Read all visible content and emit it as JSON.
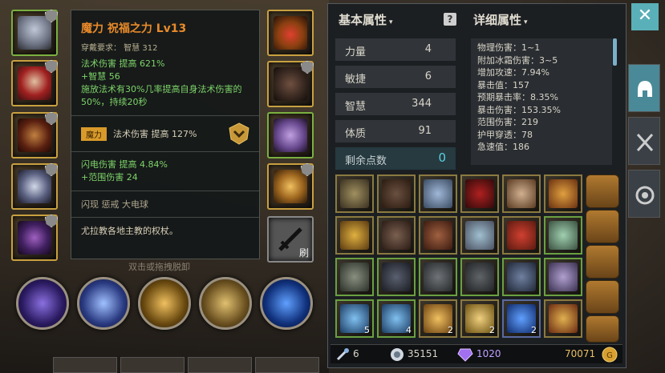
{
  "tooltip": {
    "title": "魔力 祝福之力 Lv13",
    "requirement": "穿戴要求：  智慧 312",
    "bonus1": "法术伤害 提高 621%",
    "bonus2": "+智慧 56",
    "bonus3": "施放法术有30%几率提高自身法术伤害的50%，持续20秒",
    "magic_tag": "魔力",
    "magic_bonus": "法术伤害 提高 127%",
    "lightning": "闪电伤害 提高 4.84%",
    "range": "+范围伤害 24",
    "skills": "闪现   惩戒   大电球",
    "lore": "尤拉教各地主教的权杖。"
  },
  "hint": "双击或拖拽脱卸",
  "brush_label": "刷",
  "basic_header": "基本属性",
  "detail_header": "详细属性",
  "header_arrow": "▾",
  "stats": [
    {
      "label": "力量",
      "value": "4"
    },
    {
      "label": "敏捷",
      "value": "6"
    },
    {
      "label": "智慧",
      "value": "344"
    },
    {
      "label": "体质",
      "value": "91"
    }
  ],
  "remaining": {
    "label": "剩余点数",
    "value": "0"
  },
  "details": [
    "物理伤害：1~1",
    "附加冰霜伤害：3~5",
    "增加攻速：7.94%",
    "暴击值：157",
    "预期暴击率：8.35%",
    "暴击伤害：153.35%",
    "范围伤害：219",
    "护甲穿透：78",
    "急速值：186"
  ],
  "inventory_counts": {
    "c1": "5",
    "c2": "4",
    "c3": "2",
    "c4": "2",
    "c5": "2"
  },
  "footer": {
    "keys": "6",
    "crystals": "35151",
    "gems": "1020",
    "gold": "70071"
  },
  "close_icon": "✕"
}
